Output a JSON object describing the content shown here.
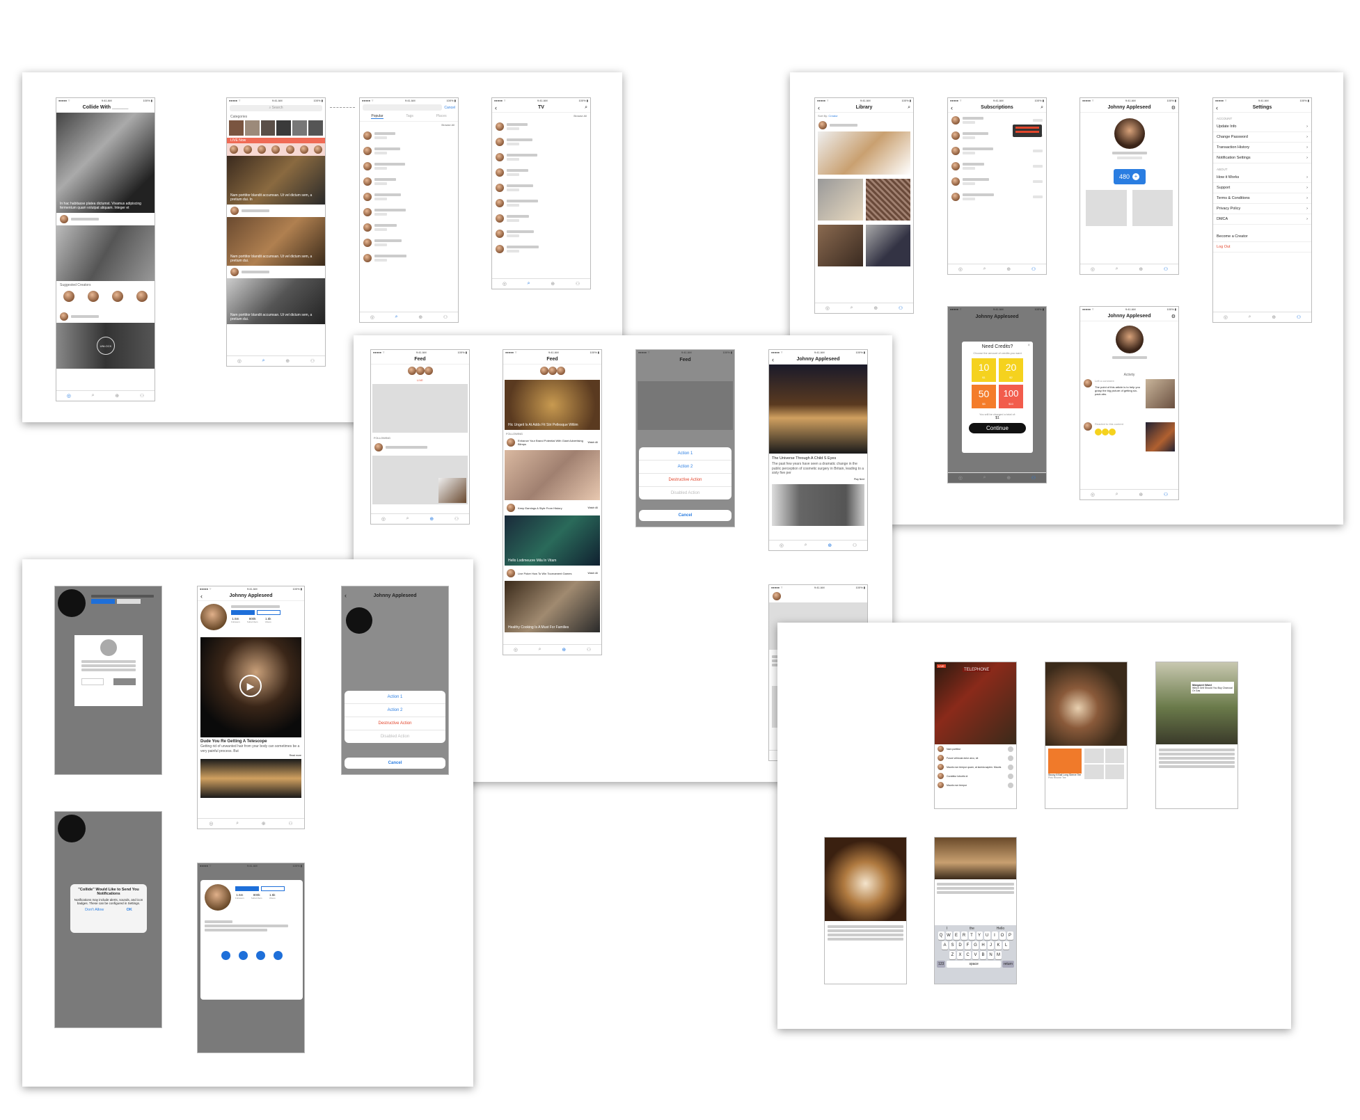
{
  "status": {
    "carrier": "●●●●● ⌔",
    "time": "9:41 AM",
    "battery": "100% ▮"
  },
  "tabbar": [
    "◎",
    "⌕",
    "⊕",
    "⚇"
  ],
  "s1": {
    "title": "Collide With ______",
    "cap1": "In hac habitasse platea dictumst. Vivamus adipiscing fermentum quam volutpat aliquam. Integer et",
    "suggested": "Suggested Creators",
    "unlock": "UNLOCK"
  },
  "s2": {
    "search": "Search",
    "categories": "Categories",
    "live": "LIVE Now",
    "cap1": "Nam porttitor blandit accumsan. Ut vel dictum sem, a pretium dui. In",
    "cap2": "Nam porttitor blandit accumsan. Ut vel dictum sem, a pretium dui.",
    "cap3": "Nam porttitor blandit accumsan. Ut vel dictum sem, a pretium dui."
  },
  "s3": {
    "cancel": "Cancel",
    "tabs": [
      "Popular",
      "Tags",
      "Places"
    ],
    "browse": "Browse All"
  },
  "s4": {
    "title": "TV",
    "browse": "Browse All"
  },
  "lib": {
    "title": "Library",
    "sortby": "Sort By:",
    "sortval": "Creator"
  },
  "subs": {
    "title": "Subscriptions"
  },
  "prof": {
    "name": "Johnny Appleseed",
    "credits_label": "Credits",
    "credits": "480",
    "activity": "Activity",
    "left": "Left a comment",
    "comment": "The point of this article is to help you grasp the big picture of getting six-pack abs.",
    "replied": "Reacted to this content"
  },
  "settings": {
    "title": "Settings",
    "account": "ACCOUNT",
    "items1": [
      "Update Info",
      "Change Password",
      "Transaction History",
      "Notification Settings"
    ],
    "about": "ABOUT",
    "items2": [
      "How it Works",
      "Support",
      "Terms & Conditions",
      "Privacy Policy",
      "DMCA"
    ],
    "creator": "Become a Creator",
    "logout": "Log Out"
  },
  "credits": {
    "title": "Need Credits?",
    "sub": "Choose the amount of credits you want",
    "opts": [
      "10",
      "20",
      "50",
      "100"
    ],
    "prices": [
      "$1",
      "$2",
      "$5",
      "$10"
    ],
    "note": "You will be charged a total of:",
    "total": "$1",
    "cont": "Continue"
  },
  "feed": {
    "title": "Feed",
    "live": "LIVE",
    "following": "FOLLOWING",
    "cap1": "Hic Ungeit Is At Adds Fit Stri Pellesque Wiliim",
    "p1": "Enhance Your Brand Potential With Giant Advertising Blimps",
    "p2": "Keep Earnings A Style From History",
    "cap2": "Hello Lodimeuore Mila In Vitam",
    "p3": "Live Poker How To Win Tournament Games",
    "cap3": "Healthy Cooking Is A Must For Families",
    "watch": "Watch All"
  },
  "sheet": {
    "a1": "Action 1",
    "a2": "Action 2",
    "destr": "Destructive Action",
    "dis": "Disabled Action",
    "cancel": "Cancel"
  },
  "post": {
    "author": "Johnny Appleseed",
    "title": "The Universe Through A Child S Eyes",
    "body": "The past few years have seen a dramatic change in the public perception of cosmetic surgery in Britain, leading to a sixty five per",
    "play": "Play Next"
  },
  "vid": {
    "name": "Johnny Appleseed",
    "stats": [
      [
        "1.5m",
        "Followers"
      ],
      [
        "800k",
        "Subscribers"
      ],
      [
        "1.5k",
        "Videos"
      ]
    ],
    "title": "Dude You Re Getting A Telescope",
    "body": "Getting rid of unwanted hair from your body can sometimes be a very painful process. But",
    "more": "Read more"
  },
  "notif": {
    "title": "\"Collide\" Would Like to Send You Notifications",
    "body": "Notifications may include alerts, sounds, and icon badges. These can be configured in Settings.",
    "deny": "Don't Allow",
    "ok": "OK"
  },
  "b3": {
    "comments": [
      "Nam porttitor",
      "Fusce vehicula dolor arcu, sit",
      "Mauris non tempor quam, at lacinia sapien. Mauris",
      "Curabitur lobortis id",
      "Mauris non tempor"
    ],
    "tag": "LIVE",
    "sign": "TELEPHONE",
    "person": "Margaret Ward",
    "quote": "Which Grill Should You Buy Charcoal Or Gas",
    "item": "Stussy 8 Ball Long Sleeve Tee",
    "price": "Pink Rhome Tee"
  },
  "kb": {
    "sug": [
      "I",
      "the",
      "Hello"
    ],
    "r1": "QWERTYUIOP",
    "r2": "ASDFGHJKL",
    "r3": "ZXCVBNM",
    "num": "123",
    "space": "space",
    "ret": "return"
  }
}
